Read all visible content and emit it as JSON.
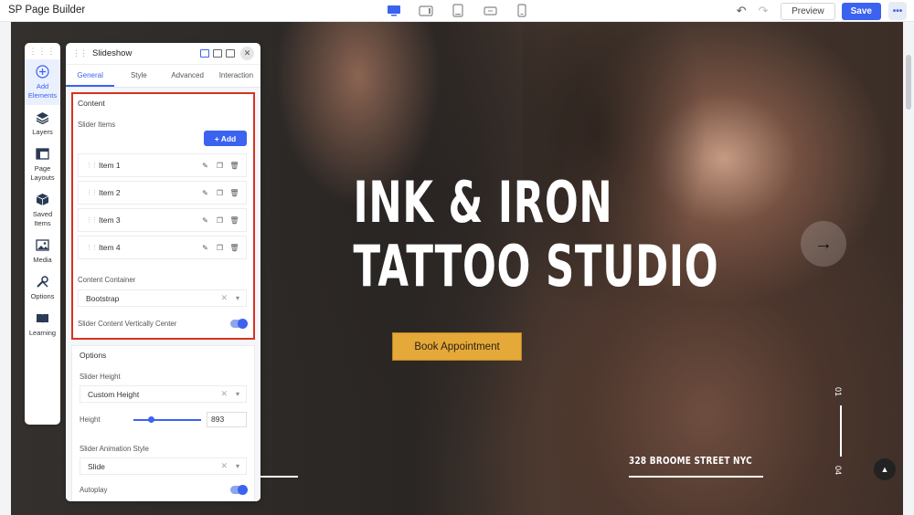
{
  "app": {
    "title": "SP Page Builder"
  },
  "toolbar": {
    "devices": [
      "desktop-icon",
      "tablet-landscape-icon",
      "tablet-portrait-icon",
      "mobile-landscape-icon",
      "mobile-portrait-icon"
    ],
    "preview_label": "Preview",
    "save_label": "Save",
    "more_label": "•••"
  },
  "sidebar": {
    "items": [
      {
        "label": "Add Elements",
        "icon": "plus-circle-icon",
        "active": true
      },
      {
        "label": "Layers",
        "icon": "layers-icon"
      },
      {
        "label": "Page Layouts",
        "icon": "layout-icon"
      },
      {
        "label": "Saved Items",
        "icon": "box-icon"
      },
      {
        "label": "Media",
        "icon": "image-icon"
      },
      {
        "label": "Options",
        "icon": "tools-icon"
      },
      {
        "label": "Learning",
        "icon": "book-icon"
      }
    ]
  },
  "panel": {
    "title": "Slideshow",
    "tabs": [
      "General",
      "Style",
      "Advanced",
      "Interaction"
    ],
    "content": {
      "title": "Content",
      "slider_items_label": "Slider Items",
      "add_label": "+ Add",
      "items": [
        "Item 1",
        "Item 2",
        "Item 3",
        "Item 4"
      ],
      "container_label": "Content Container",
      "container_value": "Bootstrap",
      "vcenter_label": "Slider Content Vertically Center",
      "vcenter_on": true
    },
    "options": {
      "title": "Options",
      "height_label": "Slider Height",
      "height_value": "Custom Height",
      "height_field_label": "Height",
      "height_number": "893",
      "animation_label": "Slider Animation Style",
      "animation_value": "Slide",
      "autoplay_label": "Autoplay",
      "autoplay_on": true
    }
  },
  "hero": {
    "title_line1": "INK & IRON",
    "title_line2": "TATTOO STUDIO",
    "cta_label": "Book Appointment",
    "address": "328 BROOME STREET NYC",
    "counter_current": "01",
    "counter_total": "04",
    "next_arrow": "→",
    "scroll_top": "▲"
  },
  "colors": {
    "accent": "#3b63f0",
    "highlight": "#d8321f",
    "cta": "#e5a93a"
  }
}
